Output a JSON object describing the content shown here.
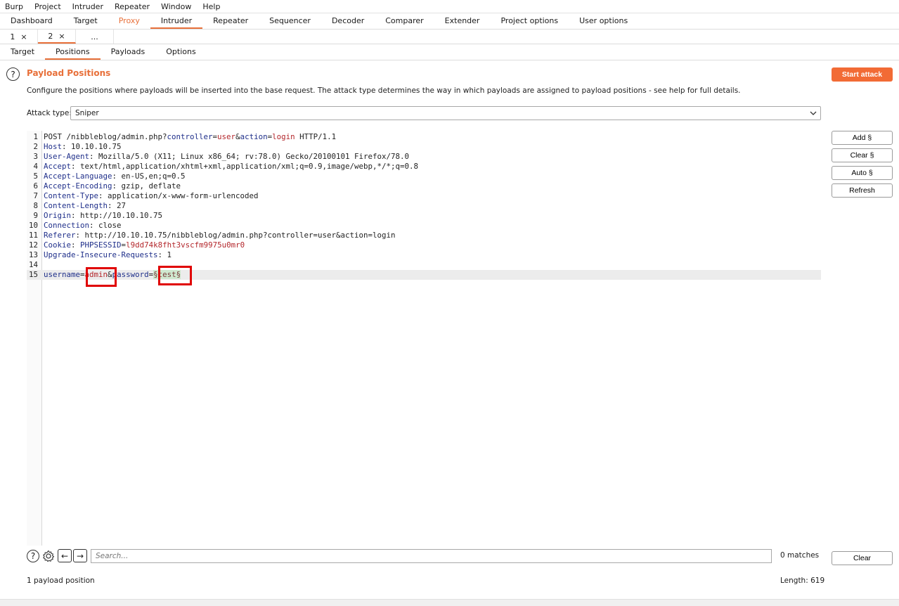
{
  "menubar": [
    "Burp",
    "Project",
    "Intruder",
    "Repeater",
    "Window",
    "Help"
  ],
  "main_tabs": [
    "Dashboard",
    "Target",
    "Proxy",
    "Intruder",
    "Repeater",
    "Sequencer",
    "Decoder",
    "Comparer",
    "Extender",
    "Project options",
    "User options"
  ],
  "main_tab_active": "Intruder",
  "main_tab_highlight": "Proxy",
  "instance_tabs": [
    {
      "label": "1",
      "close": "×"
    },
    {
      "label": "2",
      "close": "×"
    },
    {
      "label": "...",
      "close": ""
    }
  ],
  "section_tabs": [
    "Target",
    "Positions",
    "Payloads",
    "Options"
  ],
  "section_tab_active": "Positions",
  "panel": {
    "help_glyph": "?",
    "title": "Payload Positions",
    "description": "Configure the positions where payloads will be inserted into the base request. The attack type determines the way in which payloads are assigned to payload positions - see help for full details.",
    "start_button": "Start attack",
    "attack_type_label": "Attack type:",
    "attack_type_value": "Sniper"
  },
  "side_buttons": {
    "add": "Add §",
    "clear": "Clear §",
    "auto": "Auto §",
    "refresh": "Refresh"
  },
  "request_lines": [
    {
      "n": "1",
      "parts": [
        [
          "v",
          "POST /nibbleblog/admin.php?"
        ],
        [
          "k",
          "controller"
        ],
        [
          "v",
          "="
        ],
        [
          "r",
          "user"
        ],
        [
          "v",
          "&"
        ],
        [
          "k",
          "action"
        ],
        [
          "v",
          "="
        ],
        [
          "r",
          "login"
        ],
        [
          "v",
          " HTTP/1.1"
        ]
      ]
    },
    {
      "n": "2",
      "parts": [
        [
          "k",
          "Host"
        ],
        [
          "v",
          ": 10.10.10.75"
        ]
      ]
    },
    {
      "n": "3",
      "parts": [
        [
          "k",
          "User-Agent"
        ],
        [
          "v",
          ": Mozilla/5.0 (X11; Linux x86_64; rv:78.0) Gecko/20100101 Firefox/78.0"
        ]
      ]
    },
    {
      "n": "4",
      "parts": [
        [
          "k",
          "Accept"
        ],
        [
          "v",
          ": text/html,application/xhtml+xml,application/xml;q=0.9,image/webp,*/*;q=0.8"
        ]
      ]
    },
    {
      "n": "5",
      "parts": [
        [
          "k",
          "Accept-Language"
        ],
        [
          "v",
          ": en-US,en;q=0.5"
        ]
      ]
    },
    {
      "n": "6",
      "parts": [
        [
          "k",
          "Accept-Encoding"
        ],
        [
          "v",
          ": gzip, deflate"
        ]
      ]
    },
    {
      "n": "7",
      "parts": [
        [
          "k",
          "Content-Type"
        ],
        [
          "v",
          ": application/x-www-form-urlencoded"
        ]
      ]
    },
    {
      "n": "8",
      "parts": [
        [
          "k",
          "Content-Length"
        ],
        [
          "v",
          ": 27"
        ]
      ]
    },
    {
      "n": "9",
      "parts": [
        [
          "k",
          "Origin"
        ],
        [
          "v",
          ": http://10.10.10.75"
        ]
      ]
    },
    {
      "n": "10",
      "parts": [
        [
          "k",
          "Connection"
        ],
        [
          "v",
          ": close"
        ]
      ]
    },
    {
      "n": "11",
      "parts": [
        [
          "k",
          "Referer"
        ],
        [
          "v",
          ": http://10.10.10.75/nibbleblog/admin.php?controller=user&action=login"
        ]
      ]
    },
    {
      "n": "12",
      "parts": [
        [
          "k",
          "Cookie"
        ],
        [
          "v",
          ": "
        ],
        [
          "k",
          "PHPSESSID"
        ],
        [
          "v",
          "="
        ],
        [
          "r",
          "l9dd74k8fht3vscfm9975u0mr0"
        ]
      ]
    },
    {
      "n": "13",
      "parts": [
        [
          "k",
          "Upgrade-Insecure-Requests"
        ],
        [
          "v",
          ": 1"
        ]
      ]
    },
    {
      "n": "14",
      "parts": []
    },
    {
      "n": "15",
      "parts": [
        [
          "k",
          "username"
        ],
        [
          "v",
          "="
        ],
        [
          "r",
          "admin"
        ],
        [
          "v",
          "&"
        ],
        [
          "k",
          "password"
        ],
        [
          "v",
          "="
        ],
        [
          "m",
          "§test§"
        ]
      ]
    }
  ],
  "search": {
    "help_glyph": "?",
    "prev_glyph": "←",
    "next_glyph": "→",
    "placeholder": "Search...",
    "matches": "0 matches",
    "clear": "Clear"
  },
  "status": {
    "positions": "1 payload position",
    "length": "Length: 619"
  },
  "colors": {
    "accent": "#e8703a",
    "start_button": "#f26b35",
    "header_key": "#1f2f8a",
    "param_value": "#b3262b",
    "payload_marker_bg": "#cfe8cf",
    "annotation_box": "#e00000"
  }
}
